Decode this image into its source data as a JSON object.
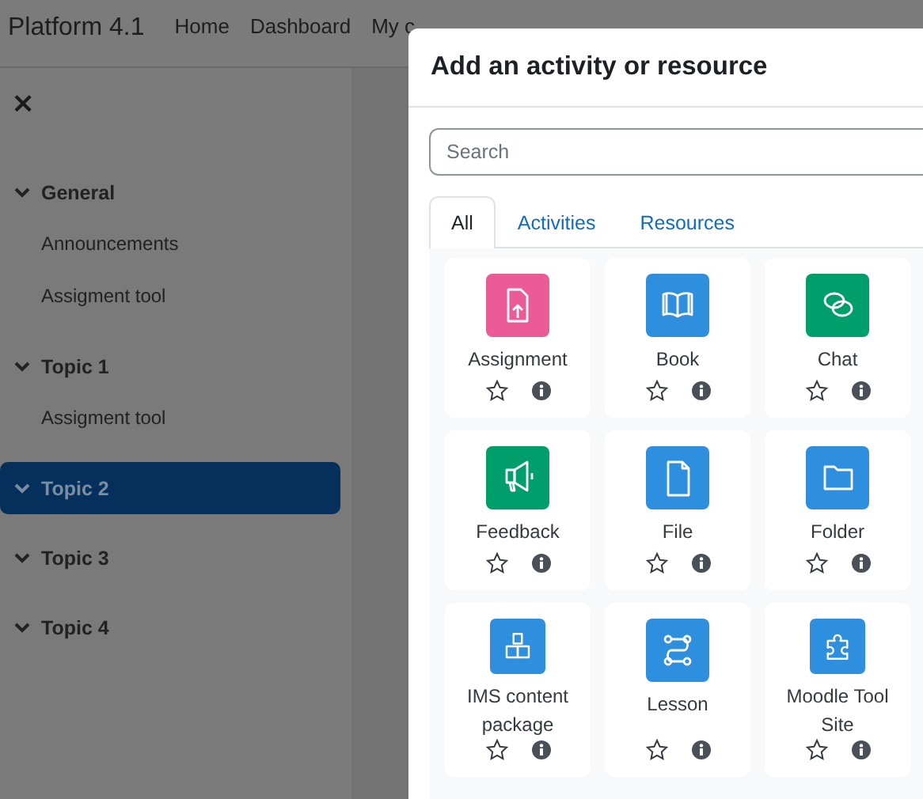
{
  "navbar": {
    "brand": "Platform 4.1",
    "links": [
      "Home",
      "Dashboard",
      "My c"
    ]
  },
  "sidebar": {
    "close": "×",
    "sections": [
      {
        "title": "General",
        "expanded": true,
        "selected": false,
        "children": [
          {
            "label": "Announcements"
          },
          {
            "label": "Assigment tool"
          }
        ]
      },
      {
        "title": "Topic 1",
        "expanded": true,
        "selected": false,
        "children": [
          {
            "label": "Assigment tool"
          }
        ]
      },
      {
        "title": "Topic 2",
        "expanded": true,
        "selected": true
      },
      {
        "title": "Topic 3",
        "expanded": true,
        "selected": false
      },
      {
        "title": "Topic 4",
        "expanded": true,
        "selected": false
      }
    ]
  },
  "modal": {
    "title": "Add an activity or resource",
    "search": {
      "placeholder": "Search"
    },
    "tabs": [
      {
        "label": "All",
        "selected": true
      },
      {
        "label": "Activities",
        "selected": false
      },
      {
        "label": "Resources",
        "selected": false
      }
    ],
    "items": [
      {
        "name": "Assignment",
        "kind": "assignment",
        "color": "#eb5c97",
        "starred": false
      },
      {
        "name": "Book",
        "kind": "book",
        "color": "#2d8fdd",
        "starred": false
      },
      {
        "name": "Chat",
        "kind": "chat",
        "color": "#009e6a",
        "starred": false
      },
      {
        "name": "Feedback",
        "kind": "megaphone",
        "color": "#009e6a",
        "starred": false
      },
      {
        "name": "File",
        "kind": "file",
        "color": "#2d8fdd",
        "starred": false
      },
      {
        "name": "Folder",
        "kind": "folder",
        "color": "#2d8fdd",
        "starred": false
      },
      {
        "name": "IMS content package",
        "kind": "boxes",
        "color": "#2d8fdd",
        "starred": false
      },
      {
        "name": "Lesson",
        "kind": "path",
        "color": "#2d8fdd",
        "starred": false
      },
      {
        "name": "Moodle Tool Site",
        "kind": "puzzle",
        "color": "#2d8fdd",
        "starred": false
      }
    ]
  }
}
